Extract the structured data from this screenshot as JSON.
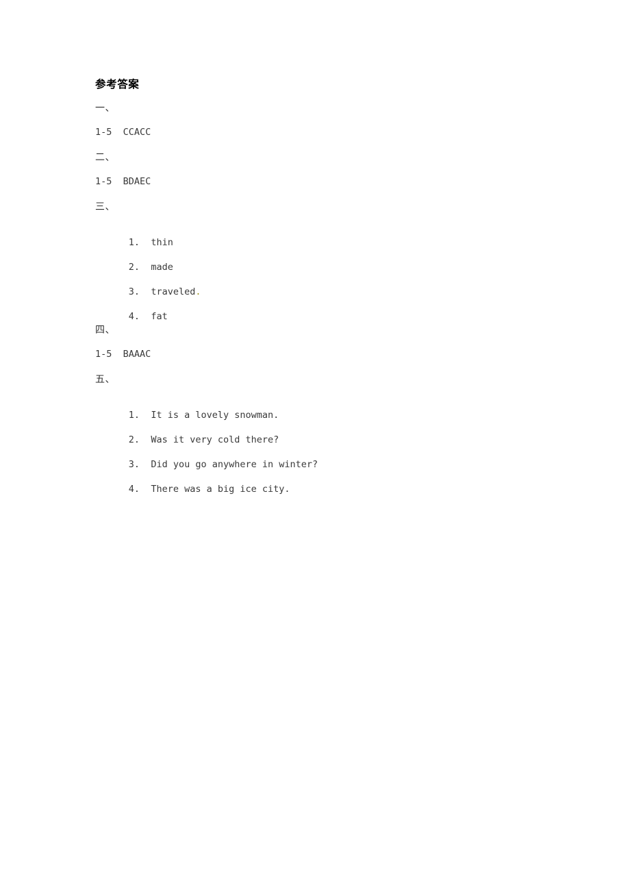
{
  "document": {
    "title": "参考答案",
    "background_color": "#ffffff",
    "text_color": "#3a3a3a",
    "accent_mark_color": "#9c9320"
  },
  "sections": [
    {
      "heading": "一、",
      "range_answer": "1-5  CCACC"
    },
    {
      "heading": "二、",
      "range_answer": "1-5  BDAEC"
    },
    {
      "heading": "三、",
      "items": [
        {
          "marker": "1.",
          "value": "thin",
          "tail": ""
        },
        {
          "marker": "2.",
          "value": "made",
          "tail": ""
        },
        {
          "marker": "3.",
          "value": "traveled",
          "tail": "."
        },
        {
          "marker": "4.",
          "value": "fat",
          "tail": ""
        }
      ]
    },
    {
      "heading": "四、",
      "range_answer": "1-5  BAAAC"
    },
    {
      "heading": "五、",
      "items": [
        {
          "marker": "1.",
          "value": "It is a lovely snowman.",
          "tail": ""
        },
        {
          "marker": "2.",
          "value": "Was it very cold there?",
          "tail": ""
        },
        {
          "marker": "3.",
          "value": "Did you go anywhere in winter?",
          "tail": ""
        },
        {
          "marker": "4.",
          "value": "There was a big ice city.",
          "tail": ""
        }
      ]
    }
  ]
}
